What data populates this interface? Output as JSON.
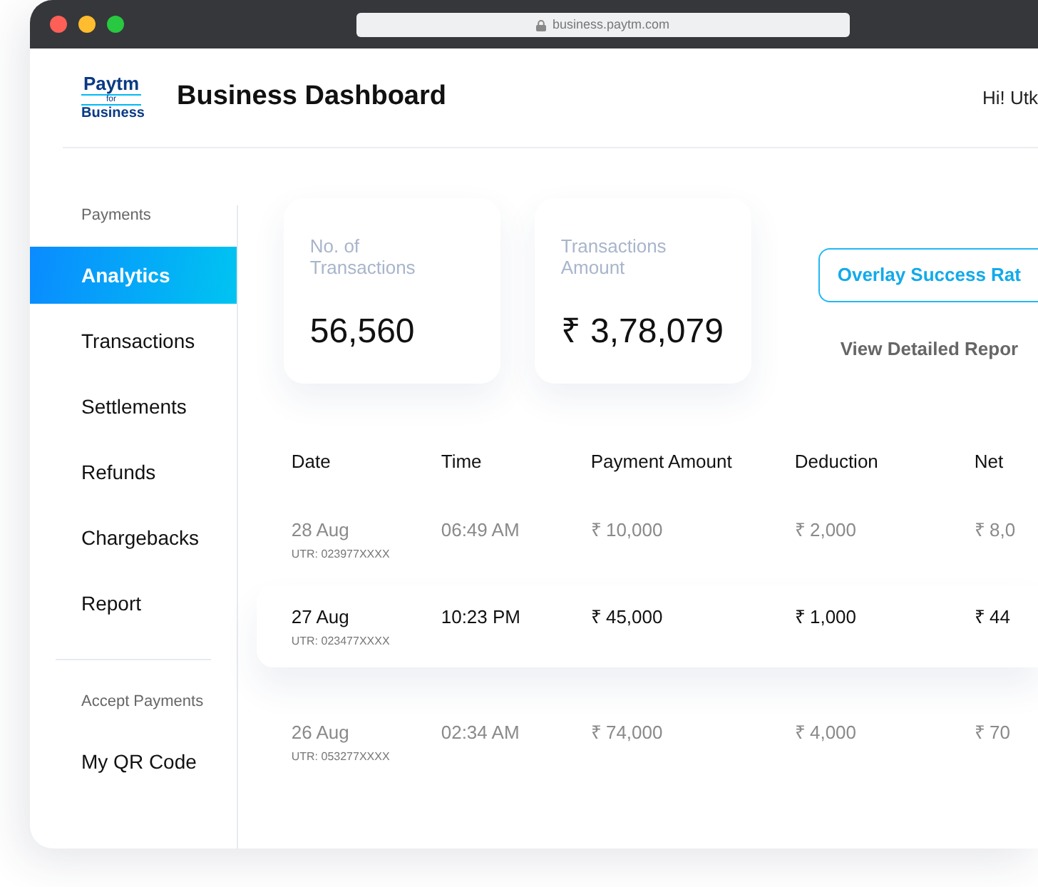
{
  "browser": {
    "url": "business.paytm.com"
  },
  "header": {
    "logo": {
      "wordmark": "Paytm",
      "tagline": "for",
      "subtitle": "Business"
    },
    "title": "Business Dashboard",
    "greeting": "Hi! Utk"
  },
  "sidebar": {
    "sections": [
      {
        "heading": "Payments",
        "items": [
          {
            "label": "Analytics",
            "selected": true
          },
          {
            "label": "Transactions",
            "selected": false
          },
          {
            "label": "Settlements",
            "selected": false
          },
          {
            "label": "Refunds",
            "selected": false
          },
          {
            "label": "Chargebacks",
            "selected": false
          },
          {
            "label": "Report",
            "selected": false
          }
        ]
      },
      {
        "heading": "Accept Payments",
        "items": [
          {
            "label": "My QR Code",
            "selected": false
          }
        ]
      }
    ]
  },
  "stats": [
    {
      "label": "No. of Transactions",
      "value": "56,560"
    },
    {
      "label": "Transactions Amount",
      "value": "₹ 3,78,079"
    }
  ],
  "actions": {
    "button": "Overlay Success Rat",
    "link": "View Detailed Repor"
  },
  "table": {
    "columns": [
      "Date",
      "Time",
      "Payment Amount",
      "Deduction",
      "Net"
    ],
    "rows": [
      {
        "cells": [
          "28 Aug",
          "06:49 AM",
          "₹ 10,000",
          "₹ 2,000",
          "₹ 8,0"
        ],
        "utr": "UTR: 023977XXXX",
        "selected": false
      },
      {
        "cells": [
          "27 Aug",
          "10:23 PM",
          "₹ 45,000",
          "₹ 1,000",
          "₹ 44"
        ],
        "utr": "UTR: 023477XXXX",
        "selected": true
      },
      {
        "cells": [
          "26 Aug",
          "02:34 AM",
          "₹ 74,000",
          "₹ 4,000",
          "₹ 70"
        ],
        "utr": "UTR: 053277XXXX",
        "selected": false
      }
    ]
  }
}
